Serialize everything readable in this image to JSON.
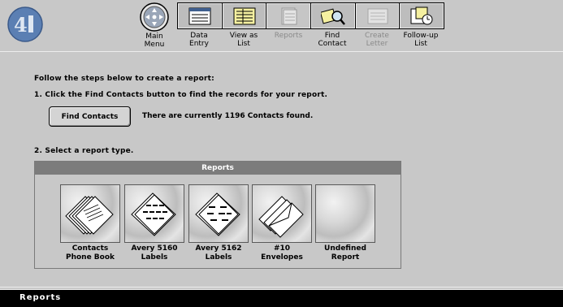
{
  "toolbar": {
    "main_menu": "Main\nMenu",
    "items": [
      {
        "label": "Data\nEntry",
        "icon": "data-entry-icon",
        "disabled": false
      },
      {
        "label": "View as\nList",
        "icon": "list-icon",
        "disabled": false
      },
      {
        "label": "Reports",
        "icon": "reports-icon",
        "disabled": true
      },
      {
        "label": "Find\nContact",
        "icon": "find-contact-icon",
        "disabled": false
      },
      {
        "label": "Create\nLetter",
        "icon": "letter-icon",
        "disabled": true
      },
      {
        "label": "Follow-up\nList",
        "icon": "follow-up-icon",
        "disabled": false
      }
    ]
  },
  "instructions": {
    "intro": "Follow the steps below to create a report:",
    "step1": "1.  Click the Find Contacts button to find the records for your report.",
    "find_button": "Find Contacts",
    "status": "There are currently 1196 Contacts found.",
    "step2": "2.  Select a report type."
  },
  "reports": {
    "header": "Reports",
    "items": [
      {
        "label": "Contacts\nPhone Book",
        "icon": "phone-book-icon"
      },
      {
        "label": "Avery 5160\nLabels",
        "icon": "labels-5160-icon"
      },
      {
        "label": "Avery 5162\nLabels",
        "icon": "labels-5162-icon"
      },
      {
        "label": "#10\nEnvelopes",
        "icon": "envelopes-icon"
      },
      {
        "label": "Undefined\nReport",
        "icon": "undefined-report-icon"
      }
    ]
  },
  "status_bar": {
    "title": "Reports"
  },
  "colors": {
    "background": "#c8c8c8",
    "header": "#7c7c7c",
    "status_bar": "#000000",
    "logo": "#4a6fa5"
  }
}
